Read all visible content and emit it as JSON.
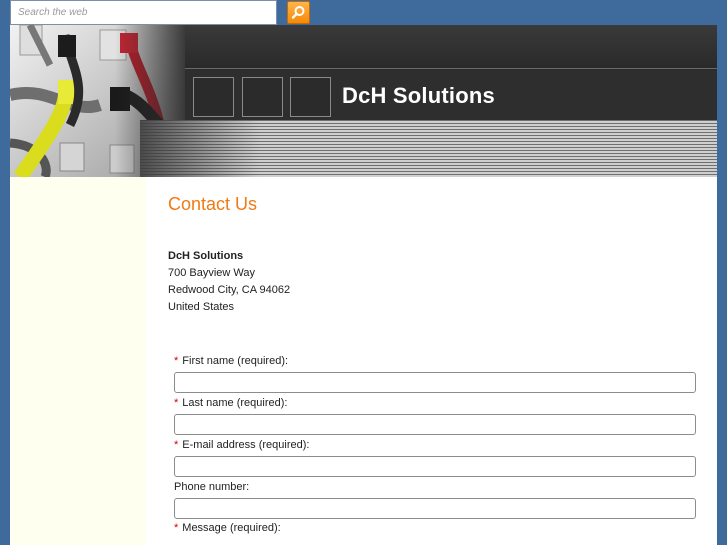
{
  "search": {
    "placeholder": "Search the web"
  },
  "header": {
    "title": "DcH Solutions"
  },
  "content": {
    "heading": "Contact Us",
    "address": {
      "name": "DcH Solutions",
      "street": "700 Bayview Way",
      "city": "Redwood City, CA 94062",
      "country": "United States"
    }
  },
  "form": {
    "required_mark": "*",
    "first_name_label": "First name (required):",
    "last_name_label": "Last name (required):",
    "email_label": "E-mail address (required):",
    "phone_label": "Phone number:",
    "message_label": "Message (required):"
  },
  "colors": {
    "background": "#3e6a9c",
    "accent": "#f07a14",
    "sidebar": "#fffff0",
    "header": "#2b2b2b"
  }
}
